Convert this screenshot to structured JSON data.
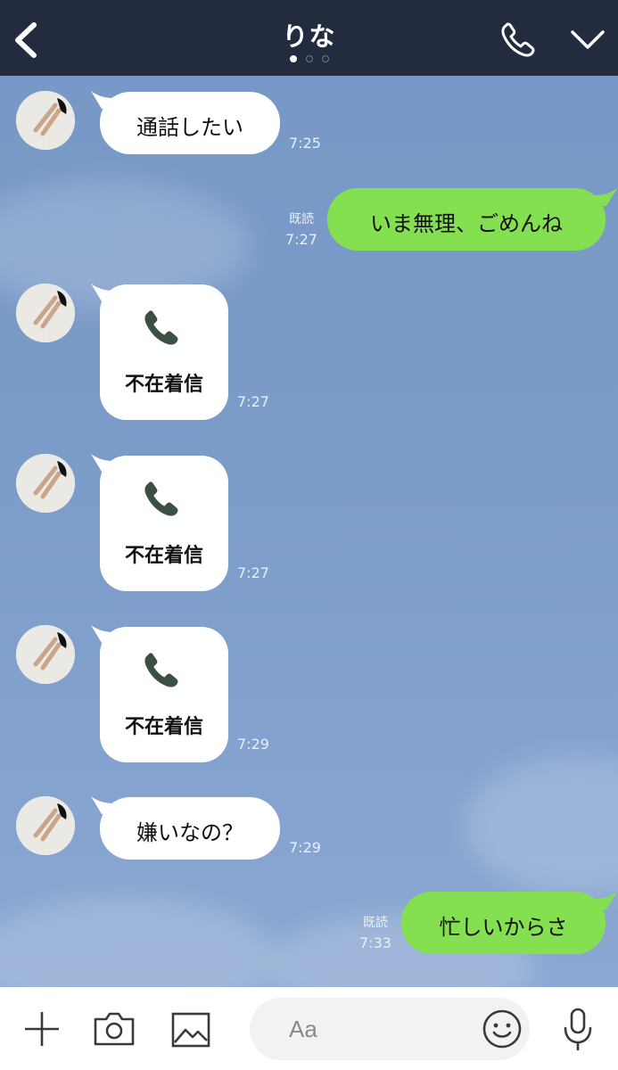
{
  "header": {
    "title": "りな",
    "page_dots": 3,
    "active_dot": 0
  },
  "messages": [
    {
      "direction": "in",
      "type": "text",
      "text": "通話したい",
      "time": "7:25"
    },
    {
      "direction": "out",
      "type": "text",
      "text": "いま無理、ごめんね",
      "time": "7:27",
      "read": "既読"
    },
    {
      "direction": "in",
      "type": "missed_call",
      "text": "不在着信",
      "time": "7:27"
    },
    {
      "direction": "in",
      "type": "missed_call",
      "text": "不在着信",
      "time": "7:27"
    },
    {
      "direction": "in",
      "type": "missed_call",
      "text": "不在着信",
      "time": "7:29"
    },
    {
      "direction": "in",
      "type": "text",
      "text": "嫌いなの？",
      "time": "7:29"
    },
    {
      "direction": "out",
      "type": "text",
      "text": "忙しいからさ",
      "time": "7:33",
      "read": "既読"
    }
  ],
  "input": {
    "placeholder": "Aa"
  },
  "toolbar": {
    "icons": [
      "plus-icon",
      "camera-icon",
      "image-icon",
      "emoji-icon",
      "microphone-icon"
    ]
  },
  "colors": {
    "header_bg": "#232c3f",
    "chat_bg": "#7b9bc8",
    "bubble_in": "#ffffff",
    "bubble_out": "#84e051",
    "phone_icon": "#3c4f43"
  }
}
